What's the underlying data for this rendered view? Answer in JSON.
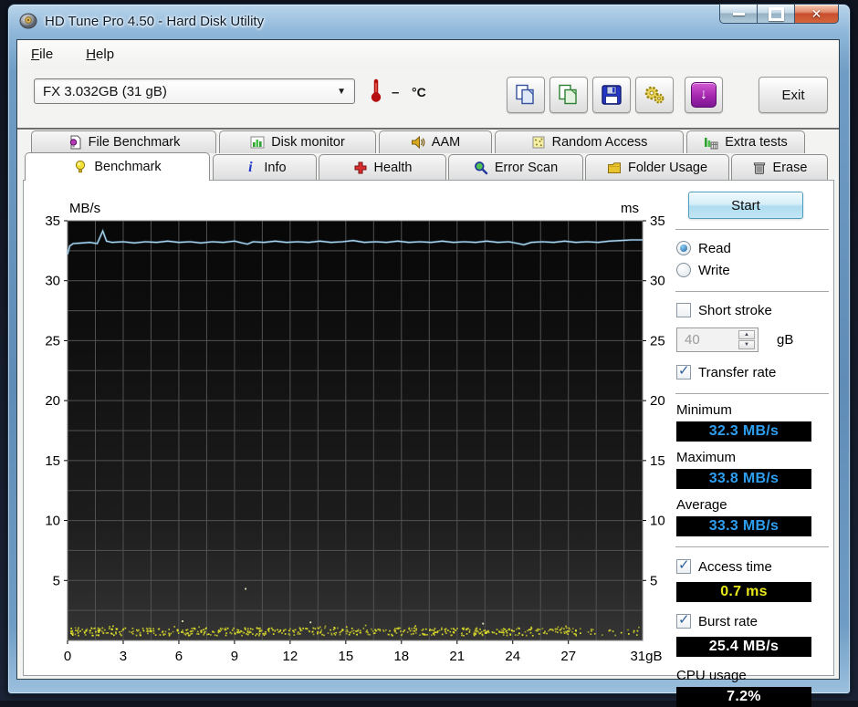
{
  "window": {
    "title": "HD Tune Pro 4.50 - Hard Disk Utility"
  },
  "menu": {
    "file": "File",
    "help": "Help"
  },
  "toolbar": {
    "drive_select": "FX 3.032GB (31 gB)",
    "temp_value": "–",
    "temp_unit": "°C",
    "exit_label": "Exit"
  },
  "icons": {
    "select_arrow": "▼",
    "update_arrow": "↓",
    "close_glyph": "✕",
    "spin_up": "▲",
    "spin_down": "▼",
    "info_glyph": "i"
  },
  "tabs": {
    "back": [
      "File Benchmark",
      "Disk monitor",
      "AAM",
      "Random Access",
      "Extra tests"
    ],
    "front": [
      "Benchmark",
      "Info",
      "Health",
      "Error Scan",
      "Folder Usage",
      "Erase"
    ],
    "active": "Benchmark"
  },
  "side": {
    "start_label": "Start",
    "read_label": "Read",
    "write_label": "Write",
    "mode_selected": "Read",
    "short_stroke_label": "Short stroke",
    "short_stroke_checked": false,
    "short_stroke_value": "40",
    "short_stroke_unit": "gB",
    "transfer_rate_label": "Transfer rate",
    "transfer_rate_checked": true,
    "stats": {
      "minimum": {
        "label": "Minimum",
        "value": "32.3 MB/s",
        "color": "#2e9ef0"
      },
      "maximum": {
        "label": "Maximum",
        "value": "33.8 MB/s",
        "color": "#2e9ef0"
      },
      "average": {
        "label": "Average",
        "value": "33.3 MB/s",
        "color": "#2e9ef0"
      }
    },
    "access_time": {
      "label": "Access time",
      "value": "0.7 ms",
      "color": "#e8e81a",
      "checked": true
    },
    "burst_rate": {
      "label": "Burst rate",
      "value": "25.4 MB/s",
      "color": "#ffffff",
      "checked": true
    },
    "cpu_usage": {
      "label": "CPU usage",
      "value": "7.2%",
      "color": "#ffffff"
    }
  },
  "chart_data": {
    "type": "line",
    "title": "HD Tune benchmark transfer-rate graph",
    "x_axis": {
      "max": 31,
      "ticks": [
        0,
        3,
        6,
        9,
        12,
        15,
        18,
        21,
        24,
        27
      ],
      "end_tick": 31,
      "end_tick_label": "31gB",
      "minor_step": 1.5
    },
    "y_left": {
      "label": "MB/s",
      "max": 35,
      "ticks": [
        5,
        10,
        15,
        20,
        25,
        30,
        35
      ],
      "minor_step": 2.5
    },
    "y_right": {
      "label": "ms",
      "max": 35,
      "ticks": [
        5,
        10,
        15,
        20,
        25,
        30,
        35
      ]
    },
    "grid": {
      "on": true
    },
    "series": [
      {
        "name": "transfer_rate_read",
        "unit": "MB/s",
        "color": "#a9d4ee",
        "points": [
          [
            0,
            32.2
          ],
          [
            0.12,
            32.9
          ],
          [
            0.3,
            33.1
          ],
          [
            0.8,
            33.15
          ],
          [
            1.2,
            33.2
          ],
          [
            1.6,
            33.1
          ],
          [
            1.9,
            34.15
          ],
          [
            2.1,
            33.3
          ],
          [
            2.4,
            33.2
          ],
          [
            3,
            33.25
          ],
          [
            3.6,
            33.15
          ],
          [
            4.2,
            33.25
          ],
          [
            4.8,
            33.2
          ],
          [
            5.4,
            33.3
          ],
          [
            6,
            33.2
          ],
          [
            6.6,
            33.25
          ],
          [
            7.2,
            33.15
          ],
          [
            7.8,
            33.25
          ],
          [
            8.4,
            33.2
          ],
          [
            9,
            33.3
          ],
          [
            9.4,
            33.15
          ],
          [
            9.7,
            33.05
          ],
          [
            10,
            33.25
          ],
          [
            10.6,
            33.2
          ],
          [
            11.2,
            33.3
          ],
          [
            11.8,
            33.2
          ],
          [
            12.4,
            33.25
          ],
          [
            13,
            33.2
          ],
          [
            13.6,
            33.3
          ],
          [
            14.2,
            33.2
          ],
          [
            14.8,
            33.25
          ],
          [
            15.4,
            33.35
          ],
          [
            16,
            33.2
          ],
          [
            16.6,
            33.25
          ],
          [
            17.2,
            33.2
          ],
          [
            17.8,
            33.3
          ],
          [
            18.4,
            33.2
          ],
          [
            19,
            33.25
          ],
          [
            19.6,
            33.2
          ],
          [
            20.2,
            33.3
          ],
          [
            20.8,
            33.2
          ],
          [
            21.4,
            33.25
          ],
          [
            22,
            33.2
          ],
          [
            22.6,
            33.3
          ],
          [
            23.2,
            33.2
          ],
          [
            23.8,
            33.25
          ],
          [
            24.3,
            33.1
          ],
          [
            24.6,
            33.0
          ],
          [
            25,
            33.2
          ],
          [
            25.6,
            33.25
          ],
          [
            26.2,
            33.2
          ],
          [
            26.8,
            33.3
          ],
          [
            27.4,
            33.2
          ],
          [
            28,
            33.25
          ],
          [
            28.6,
            33.2
          ],
          [
            29.2,
            33.3
          ],
          [
            29.8,
            33.35
          ],
          [
            30.4,
            33.4
          ],
          [
            31,
            33.4
          ]
        ]
      },
      {
        "name": "access_time_dots",
        "unit": "ms",
        "color": "#e3e32a",
        "band": {
          "count": 640,
          "x_min": 0.1,
          "x_max": 30.8,
          "y_min": 0.4,
          "y_max": 1.05,
          "fade_after_x": 27.5,
          "fade_keep_prob": 0.35,
          "seed": 42
        },
        "outliers": [
          [
            9.6,
            4.3
          ],
          [
            6.2,
            1.6
          ],
          [
            13.1,
            1.5
          ],
          [
            22.4,
            1.4
          ]
        ]
      }
    ]
  }
}
